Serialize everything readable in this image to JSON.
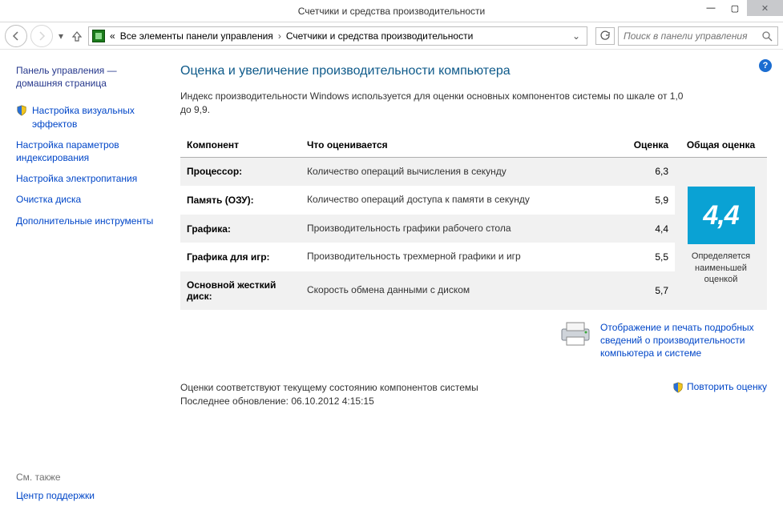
{
  "window": {
    "title": "Счетчики и средства производительности"
  },
  "breadcrumb": {
    "prefix": "«",
    "seg1": "Все элементы панели управления",
    "seg2": "Счетчики и средства производительности"
  },
  "search": {
    "placeholder": "Поиск в панели управления"
  },
  "sidebar": {
    "home": "Панель управления — домашняя страница",
    "links": {
      "visual": "Настройка визуальных эффектов",
      "index": "Настройка параметров индексирования",
      "power": "Настройка электропитания",
      "disk": "Очистка диска",
      "tools": "Дополнительные инструменты"
    },
    "see_also_label": "См. также",
    "see_also_link": "Центр поддержки"
  },
  "main": {
    "heading": "Оценка и увеличение производительности компьютера",
    "intro": "Индекс производительности Windows используется для оценки основных компонентов системы по шкале от 1,0 до 9,9.",
    "columns": {
      "component": "Компонент",
      "what": "Что оценивается",
      "score": "Оценка",
      "base": "Общая оценка"
    },
    "rows": [
      {
        "component": "Процессор:",
        "what": "Количество операций вычисления в секунду",
        "score": "6,3"
      },
      {
        "component": "Память (ОЗУ):",
        "what": "Количество операций доступа к памяти в секунду",
        "score": "5,9"
      },
      {
        "component": "Графика:",
        "what": "Производительность графики рабочего стола",
        "score": "4,4"
      },
      {
        "component": "Графика для игр:",
        "what": "Производительность трехмерной графики и игр",
        "score": "5,5"
      },
      {
        "component": "Основной жесткий диск:",
        "what": "Скорость обмена данными с диском",
        "score": "5,7"
      }
    ],
    "base_score": "4,4",
    "base_note": "Определяется наименьшей оценкой",
    "details_link": "Отображение и печать подробных сведений о производительности компьютера и системе",
    "footer_line1": "Оценки соответствуют текущему состоянию компонентов системы",
    "footer_line2": "Последнее обновление: 06.10.2012 4:15:15",
    "rerun": "Повторить оценку"
  }
}
